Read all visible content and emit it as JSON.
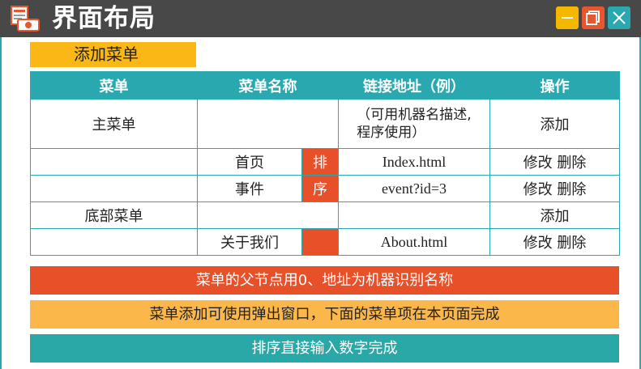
{
  "window": {
    "title": "界面布局",
    "controls": [
      "minimize-icon",
      "maximize-icon",
      "close-icon"
    ],
    "colors": {
      "minimize": "#f5b700",
      "maximize": "#e8562e",
      "close": "#2aa8b0"
    }
  },
  "add_menu_label": "添加菜单",
  "table": {
    "headers": [
      "菜单",
      "菜单名称",
      "链接地址（例）",
      "操作"
    ],
    "row_main": {
      "menu": "主菜单",
      "url_line1": "（可用机器名描述,",
      "url_line2": "程序使用）",
      "action": "添加"
    },
    "row_home": {
      "name": "首页",
      "url": "Index.html",
      "action": "修改 删除"
    },
    "row_event": {
      "name": "事件",
      "url": "event?id=3",
      "action": "修改 删除"
    },
    "row_bottom": {
      "menu": "底部菜单",
      "action": "添加"
    },
    "row_about": {
      "name": "关于我们",
      "url": "About.html",
      "action": "修改 删除"
    },
    "sort_label_1": "排",
    "sort_label_2": "序"
  },
  "notes": {
    "note1": "菜单的父节点用0、地址为机器识别名称",
    "note2": "菜单添加可使用弹出窗口，下面的菜单项在本页面完成",
    "note3": "排序直接输入数字完成"
  }
}
